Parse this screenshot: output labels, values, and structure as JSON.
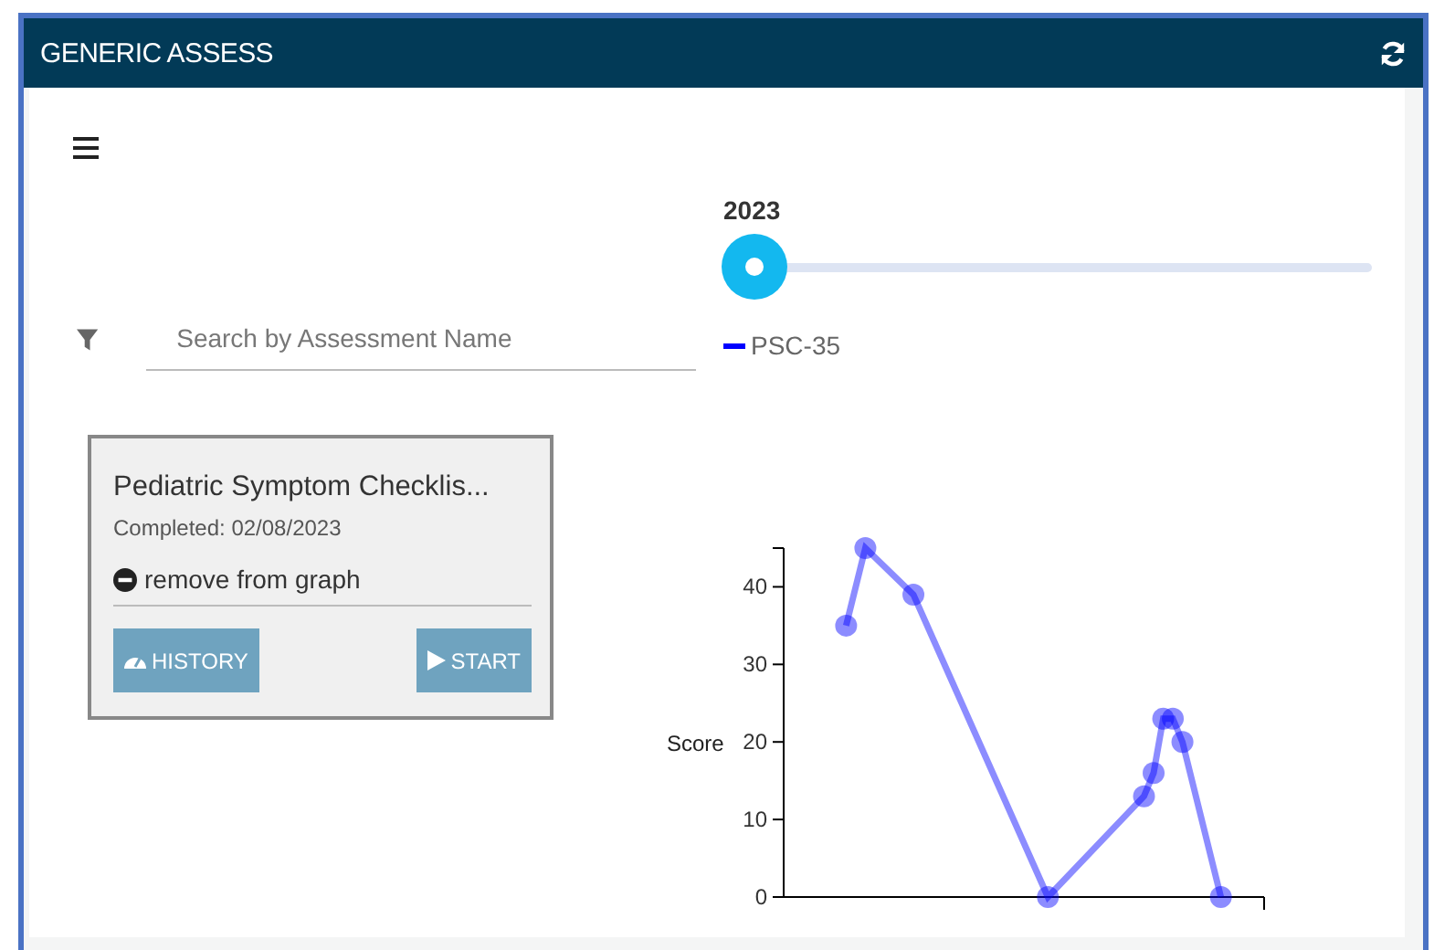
{
  "panel": {
    "title": "GENERIC ASSESS"
  },
  "slider": {
    "label": "2023",
    "level": 0
  },
  "search": {
    "placeholder": "Search by Assessment Name"
  },
  "cards": [
    {
      "title": "Pediatric Symptom Checklis...",
      "completed": "Completed: 02/08/2023",
      "remove": "remove from graph",
      "buttons": [
        {
          "kind": "history",
          "label": "HISTORY"
        },
        {
          "kind": "start",
          "label": "START"
        }
      ]
    }
  ],
  "chart_data": {
    "type": "line",
    "ylabel": "Score",
    "yticks": [
      0,
      10,
      20,
      30,
      40
    ],
    "ylim": [
      0,
      45
    ],
    "categories": [
      null,
      null,
      null,
      null,
      null,
      null,
      null,
      null,
      null,
      null,
      null,
      null,
      null,
      null,
      null,
      null,
      null,
      null,
      null,
      null,
      null,
      null,
      null,
      null,
      null,
      null,
      null,
      null,
      null,
      null,
      null,
      null,
      null,
      null,
      null,
      null,
      null,
      null,
      null,
      null,
      null,
      null,
      null,
      null,
      null,
      null,
      null,
      null,
      null,
      null
    ],
    "series": [
      {
        "name": "PSC-35",
        "color": "#0000ff",
        "marker": "circle",
        "values": [
          null,
          null,
          null,
          null,
          null,
          null,
          35,
          null,
          45,
          null,
          null,
          null,
          null,
          39,
          null,
          null,
          null,
          null,
          null,
          null,
          null,
          null,
          null,
          null,
          null,
          null,
          null,
          0,
          null,
          null,
          null,
          null,
          null,
          null,
          null,
          null,
          null,
          13,
          16,
          23,
          23,
          20,
          null,
          null,
          null,
          0,
          null,
          null,
          null,
          null
        ]
      }
    ]
  }
}
